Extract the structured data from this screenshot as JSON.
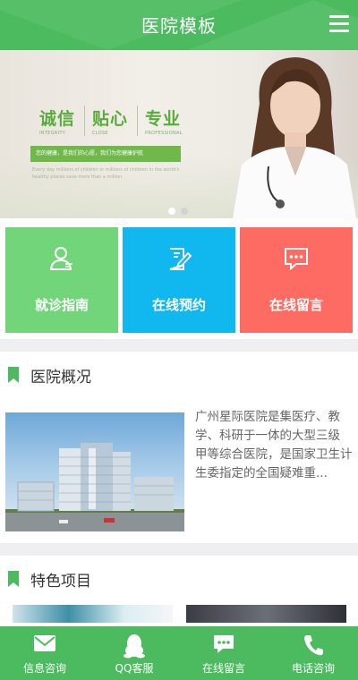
{
  "header": {
    "title": "医院模板",
    "menu_icon": "hamburger-menu-icon"
  },
  "banner": {
    "slogans": [
      {
        "cn": "诚信",
        "en": "INTEGRITY"
      },
      {
        "cn": "贴心",
        "en": "CLOSE"
      },
      {
        "cn": "专业",
        "en": "PROFESSIONAL"
      }
    ],
    "strip_text": "您的健康，是我们的心愿，我们为您健康护航",
    "small_text": "Every day millions of children in millions of children in the world's healthy places save more than a million",
    "active_slide": 1,
    "slide_count": 2
  },
  "cards": [
    {
      "label": "就诊指南",
      "icon": "user-guide-icon",
      "color": "#72d57a"
    },
    {
      "label": "在线预约",
      "icon": "edit-appointment-icon",
      "color": "#11b8f0"
    },
    {
      "label": "在线留言",
      "icon": "message-bubble-icon",
      "color": "#fd6b63"
    }
  ],
  "about": {
    "title": "医院概况",
    "text": "广州星际医院是集医疗、教学、科研于一体的大型三级 甲等综合医院，是国家卫生计生委指定的全国疑难重..."
  },
  "features": {
    "title": "特色项目"
  },
  "bottom_nav": [
    {
      "label": "信息咨询",
      "icon": "envelope-icon"
    },
    {
      "label": "QQ客服",
      "icon": "qq-penguin-icon"
    },
    {
      "label": "在线留言",
      "icon": "chat-bubble-icon"
    },
    {
      "label": "电话咨询",
      "icon": "phone-icon"
    }
  ],
  "colors": {
    "brand": "#4cbb5f"
  }
}
